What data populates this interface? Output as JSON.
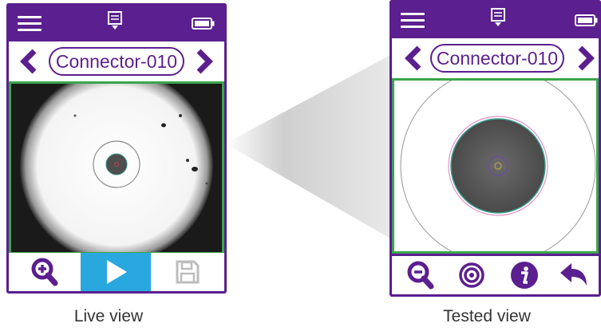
{
  "connector_label": "Connector-010",
  "captions": {
    "live": "Live view",
    "tested": "Tested view"
  },
  "colors": {
    "brand_purple": "#5b1f8f",
    "frame_green": "#3aa64a",
    "play_blue": "#29a8e0"
  },
  "icons": {
    "top": [
      "menu-icon",
      "document-download-icon",
      "battery-icon"
    ],
    "nav": [
      "chevron-left-icon",
      "chevron-right-icon"
    ],
    "live_bottom": [
      "zoom-in-icon",
      "play-icon",
      "save-icon"
    ],
    "tested_bottom": [
      "zoom-out-icon",
      "target-icon",
      "info-icon",
      "back-icon"
    ]
  }
}
